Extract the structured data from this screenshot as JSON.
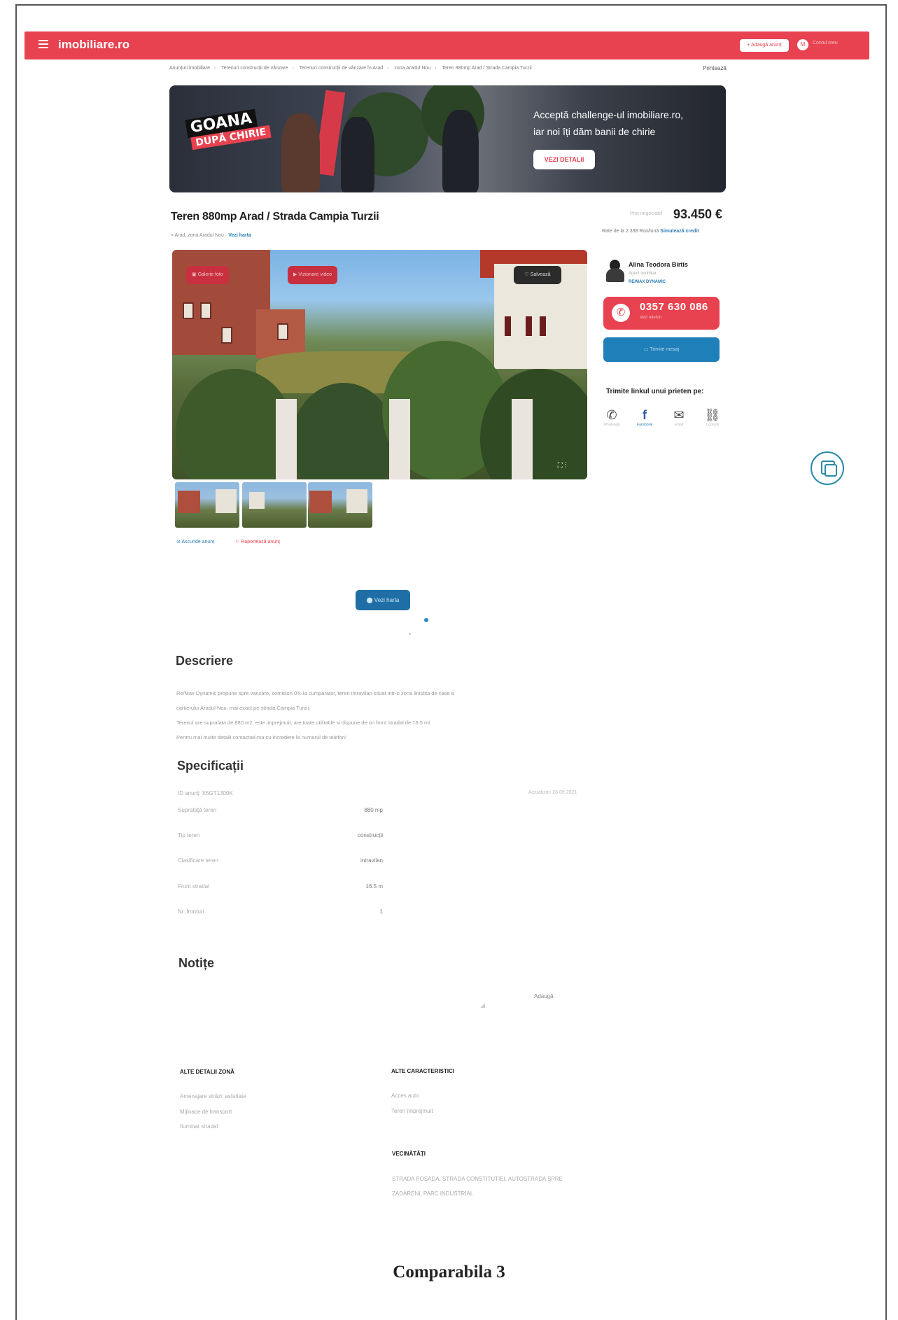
{
  "header": {
    "logo": "imobiliare.ro",
    "add_button": "+ Adaugă anunț",
    "account_initial": "M",
    "account_label": "Contul meu"
  },
  "breadcrumbs": [
    "Anunțuri imobiliare",
    "Terenuri construcții de vânzare",
    "Terenuri construcții de vânzare în Arad",
    "zona Aradul Nou",
    "Teren 880mp Arad / Strada Campia Turzii"
  ],
  "print_label": "Printează",
  "banner": {
    "title_line1": "GOANA",
    "title_line2": "DUPĂ CHIRIE",
    "text_line1": "Acceptă challenge-ul imobiliare.ro,",
    "text_line2": "iar noi îți dăm banii de chirie",
    "button": "VEZI DETALII"
  },
  "listing": {
    "title": "Teren 880mp Arad / Strada Campia Turzii",
    "location": "Arad, zona Aradul Nou",
    "location_link": "Vezi harta",
    "price_old": "Preț negociabil",
    "price": "93.450 €",
    "price_sub": "Rate de la 2.338 Ron/lună",
    "price_sub_link": "Simulează credit",
    "photo_btn1": "Galerie foto",
    "photo_btn2": "Vizionare video",
    "save_button": "Salvează",
    "actions": {
      "hide": "Ascunde anunț",
      "report": "Raportează anunț"
    }
  },
  "agent": {
    "name": "Alina Teodora Birtis",
    "role": "Agent imobiliar",
    "agency": "RE/MAX DYNAMIC",
    "phone": "0357 630 086",
    "phone_sub": "Vezi telefon",
    "message_button": "Trimite mesaj",
    "share_title": "Trimite linkul unui prieten pe:",
    "share": [
      "WhatsApp",
      "Facebook",
      "Email",
      "Copiază"
    ]
  },
  "map_button": "Vezi harta",
  "description": {
    "heading": "Descriere",
    "lines": [
      "Re/Max Dynamic propune spre vanzare, comision 0% la cumparator, teren intravilan situat intr-o zona linistita de case a",
      "cartierului Aradul Nou, mai exact pe strada Campia Turzii.",
      "Terenul are suprafata de 880 m2, este imprejmuit, are toate utilitatile si dispune de un front stradal de 16.5 ml.",
      "Pentru mai multe detalii contactati-ma cu incredere la numarul de telefon!"
    ]
  },
  "specs": {
    "heading": "Specificații",
    "id_label": "ID anunț: X6GT1300K",
    "updated": "Actualizat: 28.09.2021",
    "rows": [
      {
        "k": "Suprafață teren",
        "v": "880 mp"
      },
      {
        "k": "Tip teren",
        "v": "construcții"
      },
      {
        "k": "Clasificare teren",
        "v": "intravilan"
      },
      {
        "k": "Front stradal",
        "v": "16.5 m"
      },
      {
        "k": "Nr. fronturi",
        "v": "1"
      }
    ]
  },
  "notes": {
    "heading": "Notițe",
    "add": "Adaugă"
  },
  "zone": {
    "heading": "ALTE DETALII ZONĂ",
    "items": [
      "Amenajare străzi: asfaltate",
      "Mijloace de transport",
      "Iluminat stradal"
    ]
  },
  "features": {
    "heading": "ALTE CARACTERISTICI",
    "items": [
      "Acces auto",
      "Teren împrejmuit"
    ]
  },
  "neighborhood": {
    "heading": "VECINĂTĂȚI",
    "line1": "STRADA POSADA, STRADA CONSTITUTIEI, AUTOSTRADA SPRE",
    "line2": "ZADARENI, PARC INDUSTRIAL"
  },
  "caption": "Comparabila 3",
  "colors": {
    "brand": "#e8414f",
    "link": "#2a7db8",
    "button_blue": "#1f7fb9"
  }
}
